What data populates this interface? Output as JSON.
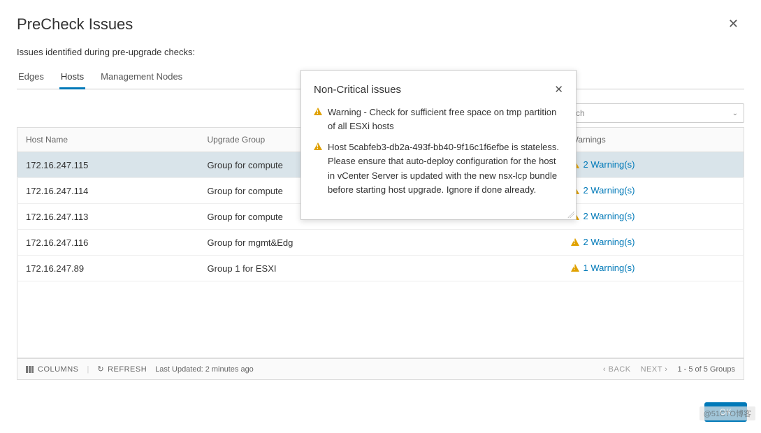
{
  "header": {
    "title": "PreCheck Issues",
    "subtitle": "Issues identified during pre-upgrade checks:"
  },
  "tabs": [
    {
      "label": "Edges",
      "active": false
    },
    {
      "label": "Hosts",
      "active": true
    },
    {
      "label": "Management Nodes",
      "active": false
    }
  ],
  "search": {
    "placeholder": "ch"
  },
  "table": {
    "columns": {
      "host": "Host Name",
      "group": "Upgrade Group",
      "warnings": "Warnings"
    },
    "rows": [
      {
        "host": "172.16.247.115",
        "group": "Group for compute",
        "warnings": "2 Warning(s)",
        "selected": true
      },
      {
        "host": "172.16.247.114",
        "group": "Group for compute",
        "warnings": "2 Warning(s)",
        "selected": false
      },
      {
        "host": "172.16.247.113",
        "group": "Group for compute",
        "warnings": "2 Warning(s)",
        "selected": false
      },
      {
        "host": "172.16.247.116",
        "group": "Group for mgmt&Edg",
        "warnings": "2 Warning(s)",
        "selected": false
      },
      {
        "host": "172.16.247.89",
        "group": "Group 1 for ESXI",
        "warnings": "1 Warning(s)",
        "selected": false
      }
    ]
  },
  "footer": {
    "columns_label": "COLUMNS",
    "refresh_label": "REFRESH",
    "last_updated": "Last Updated: 2 minutes ago",
    "back_label": "BACK",
    "next_label": "NEXT",
    "pagination": "1 - 5 of 5 Groups"
  },
  "buttons": {
    "ok": "OK"
  },
  "popover": {
    "title": "Non-Critical issues",
    "items": [
      "Warning - Check for sufficient free space on tmp partition of all ESXi hosts",
      "Host 5cabfeb3-db2a-493f-bb40-9f16c1f6efbe is stateless. Please ensure that auto-deploy configuration for the host in vCenter Server is updated with the new nsx-lcp bundle before starting host upgrade. Ignore if done already."
    ]
  },
  "watermark": "@51CTO博客"
}
